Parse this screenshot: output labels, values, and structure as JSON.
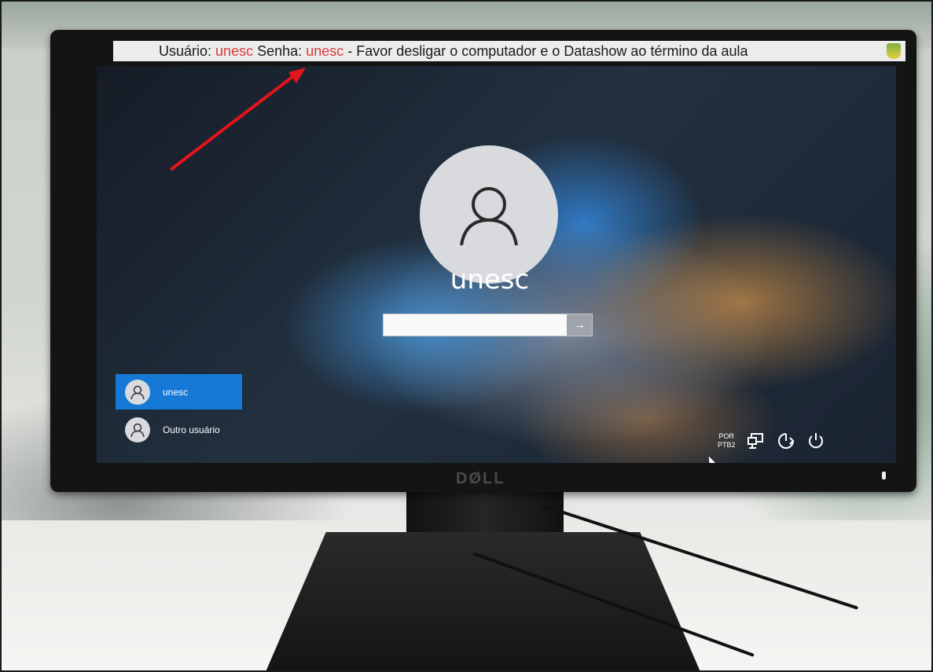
{
  "banner": {
    "label_user": "Usuário:",
    "user_value": "unesc",
    "label_password": "Senha:",
    "password_value": "unesc",
    "message": "-  Favor desligar o computador e o Datashow ao término da aula"
  },
  "login": {
    "username": "unesc",
    "password_value": "",
    "submit_icon": "arrow-right-icon"
  },
  "user_list": [
    {
      "label": "unesc",
      "selected": true
    },
    {
      "label": "Outro usuário",
      "selected": false
    }
  ],
  "tray": {
    "language_line1": "POR",
    "language_line2": "PTB2",
    "icons": [
      "network-icon",
      "ease-of-access-icon",
      "power-icon"
    ]
  },
  "monitor": {
    "brand": "DØLL"
  },
  "colors": {
    "selected_tile": "#1679d6",
    "banner_highlight": "#d93b3b",
    "annotation_arrow": "#e3141b"
  }
}
